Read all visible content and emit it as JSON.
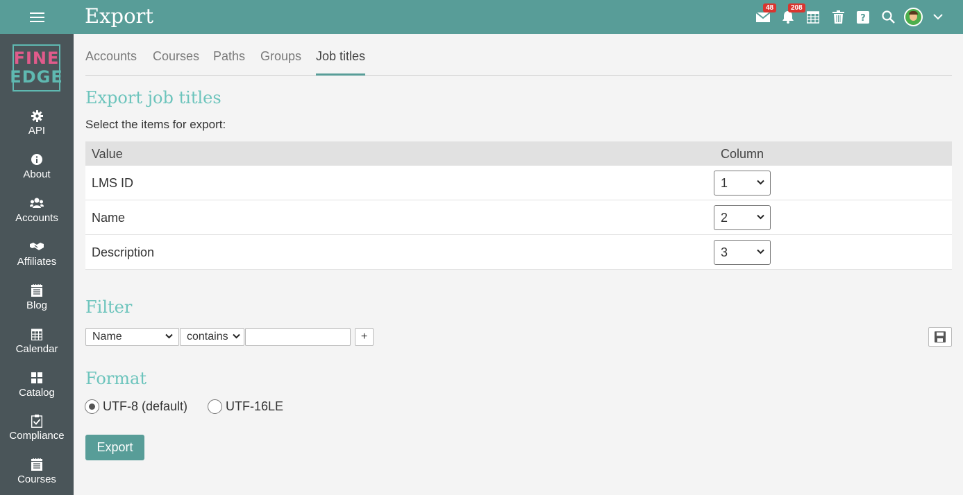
{
  "header": {
    "title": "Export",
    "messages_badge": "48",
    "notifications_badge": "208",
    "icons": [
      "menu-icon",
      "envelope-icon",
      "bell-icon",
      "calendar-icon",
      "trash-icon",
      "help-icon",
      "search-icon",
      "avatar",
      "chevron-down-icon"
    ]
  },
  "sidebar": {
    "logo": {
      "line1": "FINE",
      "line2": "EDGE"
    },
    "items": [
      {
        "label": "API",
        "icon": "gear-icon"
      },
      {
        "label": "About",
        "icon": "info-icon"
      },
      {
        "label": "Accounts",
        "icon": "users-icon"
      },
      {
        "label": "Affiliates",
        "icon": "handshake-icon"
      },
      {
        "label": "Blog",
        "icon": "notepad-icon"
      },
      {
        "label": "Calendar",
        "icon": "calendar-icon"
      },
      {
        "label": "Catalog",
        "icon": "grid-icon"
      },
      {
        "label": "Compliance",
        "icon": "clipboard-check-icon"
      },
      {
        "label": "Courses",
        "icon": "notepad-icon"
      }
    ]
  },
  "tabs": [
    {
      "label": "Accounts",
      "active": false
    },
    {
      "label": "Courses",
      "active": false
    },
    {
      "label": "Paths",
      "active": false
    },
    {
      "label": "Groups",
      "active": false
    },
    {
      "label": "Job titles",
      "active": true
    }
  ],
  "export_section": {
    "heading": "Export job titles",
    "instruction": "Select the items for export:",
    "table": {
      "headers": {
        "value": "Value",
        "column": "Column"
      },
      "rows": [
        {
          "value": "LMS ID",
          "column": "1"
        },
        {
          "value": "Name",
          "column": "2"
        },
        {
          "value": "Description",
          "column": "3"
        }
      ]
    }
  },
  "filter": {
    "heading": "Filter",
    "field_selected": "Name",
    "operator_selected": "contains",
    "value": "",
    "add_label": "+"
  },
  "format": {
    "heading": "Format",
    "options": [
      {
        "label": "UTF-8 (default)",
        "checked": true
      },
      {
        "label": "UTF-16LE",
        "checked": false
      }
    ]
  },
  "actions": {
    "export_label": "Export"
  },
  "colors": {
    "topbar": "#589d98",
    "sidebar": "#4a5559",
    "heading": "#6cc4bc",
    "badge": "#d9352f"
  }
}
